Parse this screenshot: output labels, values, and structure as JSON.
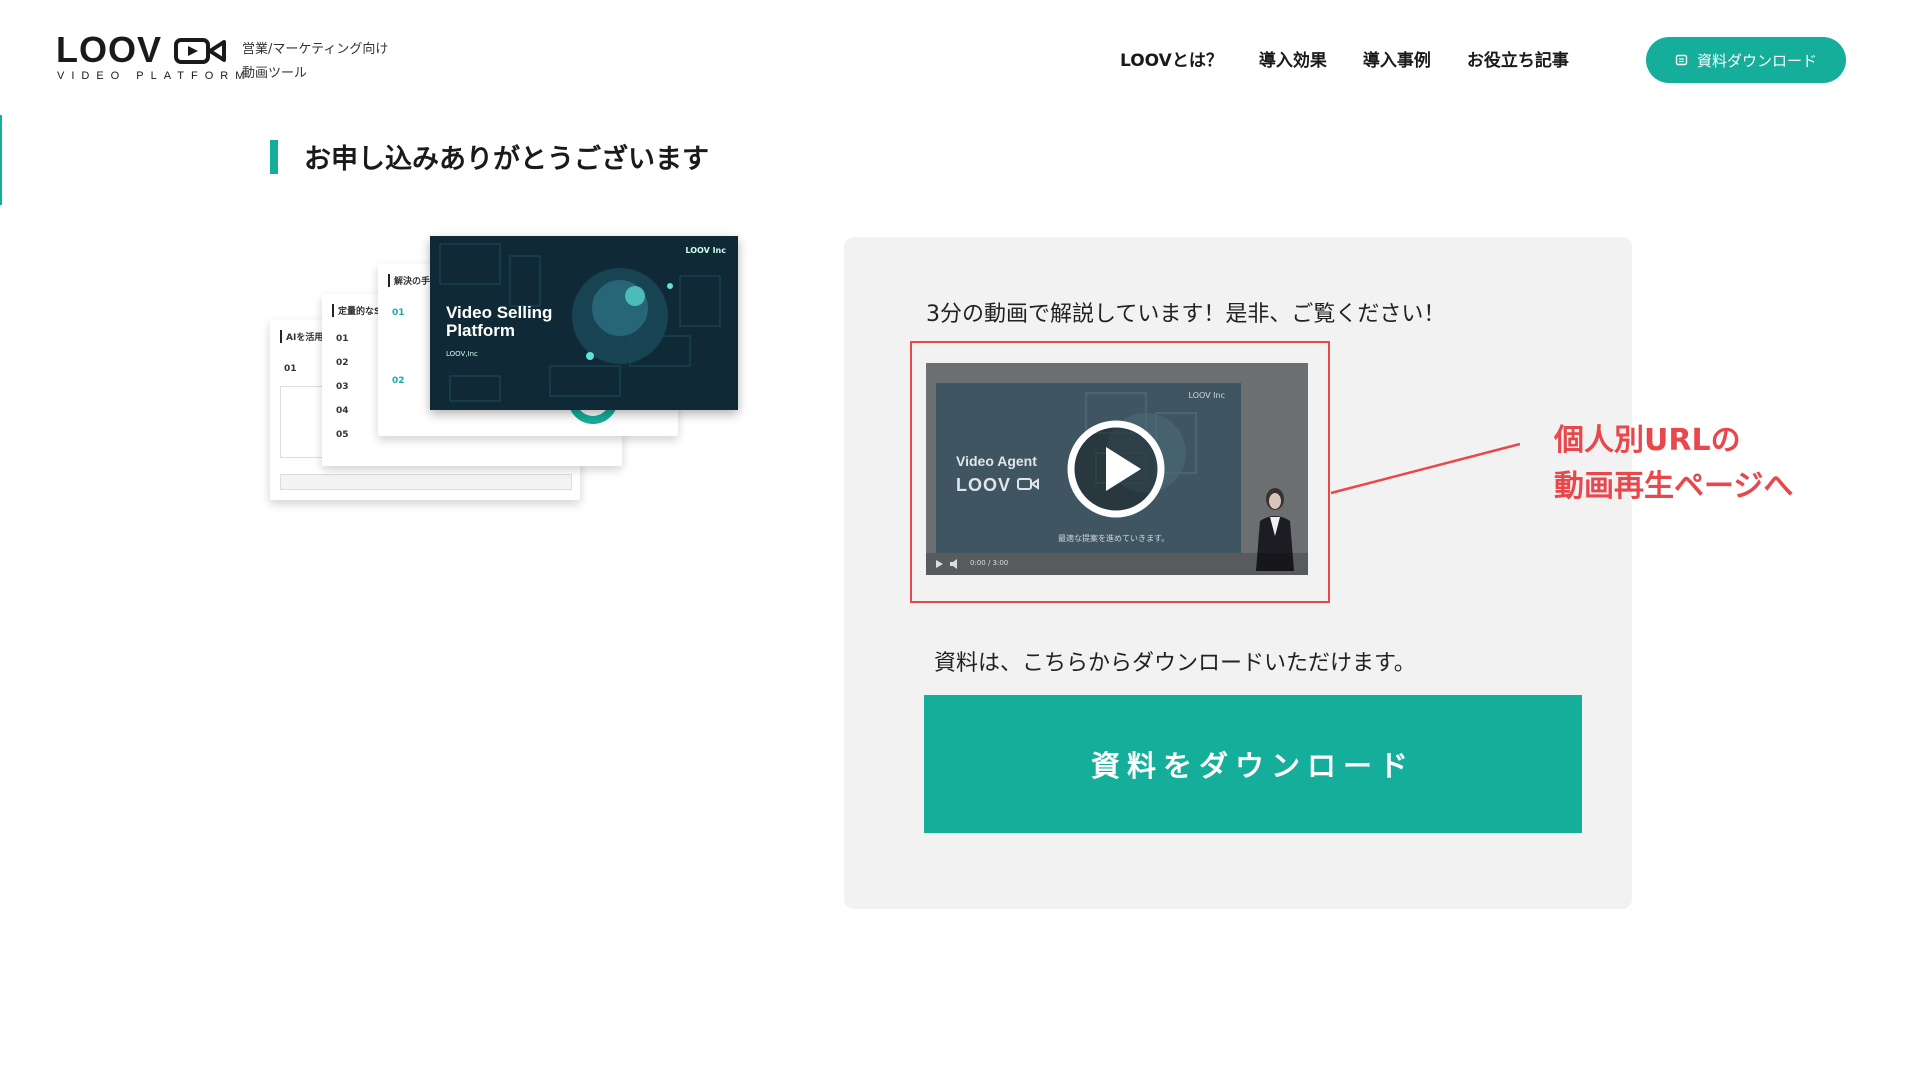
{
  "header": {
    "logo_text": "LOOV",
    "logo_sub": "VIDEO PLATFORM",
    "tagline_line1": "営業/マーケティング向け",
    "tagline_line2": "動画ツール",
    "nav": [
      "LOOVとは？",
      "導入効果",
      "導入事例",
      "お役立ち記事"
    ],
    "download_label": "資料ダウンロード",
    "download_icon": "document-icon"
  },
  "page": {
    "heading": "お申し込みありがとうございます"
  },
  "slides": {
    "cover_title_line1": "Video Selling",
    "cover_title_line2": "Platform",
    "cover_sub": "LOOV,Inc",
    "cover_brand": "LOOV Inc",
    "slide1_title": "AIを活用し",
    "slide2_title": "定量的なS",
    "slide3_title": "解決の手段",
    "rows": [
      "01",
      "02",
      "03",
      "04",
      "05"
    ]
  },
  "card": {
    "video_caption": "3分の動画で解説しています！是非、ご覧ください！",
    "video_title": "Video Agent",
    "video_logo": "LOOV",
    "video_brand": "LOOV Inc",
    "video_subtitle": "最適な提案を進めていきます。",
    "video_time": "0:00 / 3:00",
    "annotation_line1": "個人別URLの",
    "annotation_line2": "動画再生ページへ",
    "download_caption": "資料は、こちらからダウンロードいただけます。",
    "download_button": "資料をダウンロード"
  },
  "colors": {
    "accent": "#14ae9a",
    "annotation": "#e8474c",
    "card_bg": "#f2f2f2"
  }
}
